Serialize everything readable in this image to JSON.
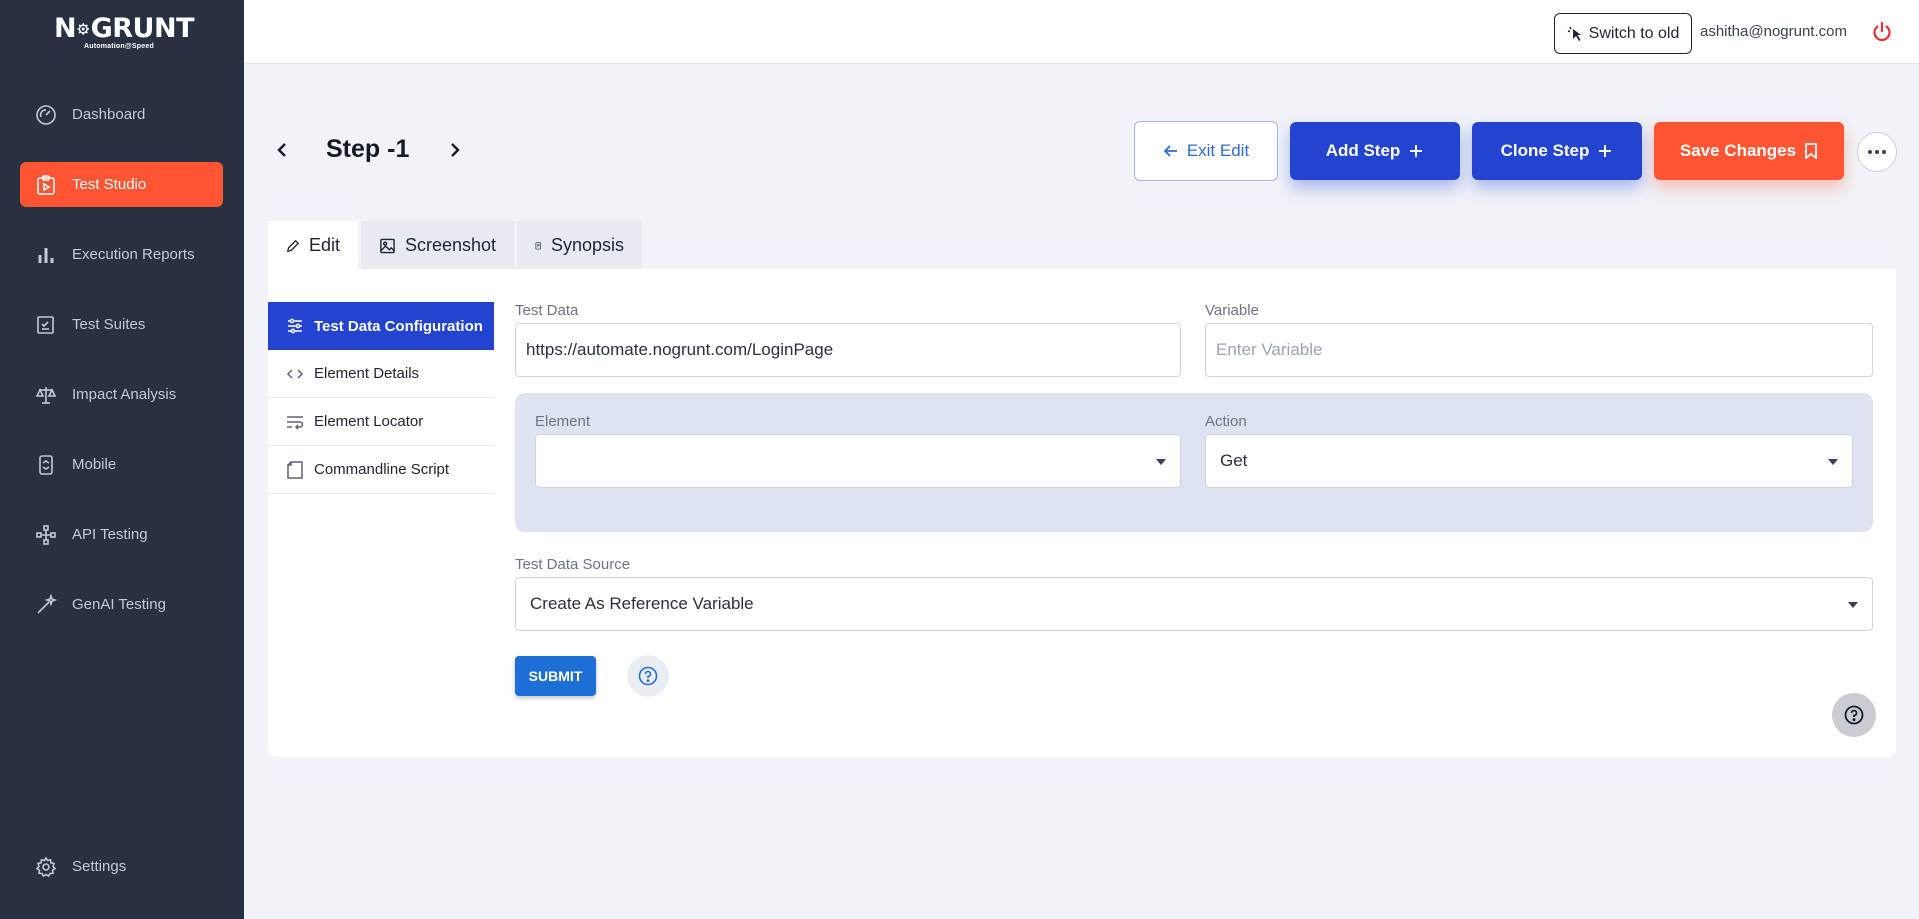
{
  "brand": {
    "name_left": "N",
    "name_right": "GRUNT",
    "tagline": "Automation@Speed"
  },
  "sidebar": {
    "items": [
      {
        "label": "Dashboard",
        "icon": "gauge-icon"
      },
      {
        "label": "Test Studio",
        "icon": "clipboard-play-icon",
        "active": true
      },
      {
        "label": "Execution Reports",
        "icon": "bar-chart-icon"
      },
      {
        "label": "Test Suites",
        "icon": "checklist-icon"
      },
      {
        "label": "Impact Analysis",
        "icon": "scale-icon"
      },
      {
        "label": "Mobile",
        "icon": "mobile-icon"
      },
      {
        "label": "API Testing",
        "icon": "api-nodes-icon"
      },
      {
        "label": "GenAI Testing",
        "icon": "magic-wand-icon"
      }
    ],
    "settings_label": "Settings"
  },
  "topbar": {
    "switch_label": "Switch to old",
    "user_email": "ashitha@nogrunt.com"
  },
  "header": {
    "step_title": "Step -1",
    "exit_label": "Exit Edit",
    "add_label": "Add Step",
    "clone_label": "Clone Step",
    "save_label": "Save Changes"
  },
  "tabs": [
    {
      "label": "Edit",
      "active": true
    },
    {
      "label": "Screenshot"
    },
    {
      "label": "Synopsis"
    }
  ],
  "subnav": [
    {
      "label": "Test Data Configuration",
      "active": true
    },
    {
      "label": "Element Details"
    },
    {
      "label": "Element Locator"
    },
    {
      "label": "Commandline Script"
    }
  ],
  "form": {
    "test_data_label": "Test Data",
    "test_data_value": "https://automate.nogrunt.com/LoginPage",
    "variable_label": "Variable",
    "variable_placeholder": "Enter Variable",
    "element_label": "Element",
    "element_value": "",
    "action_label": "Action",
    "action_value": "Get",
    "source_label": "Test Data Source",
    "source_value": "Create As Reference Variable",
    "submit_label": "SUBMIT"
  },
  "colors": {
    "sidebar_bg": "#283142",
    "accent_orange": "#ff5533",
    "primary_blue": "#2344d0",
    "submit_blue": "#1d6fd6"
  }
}
